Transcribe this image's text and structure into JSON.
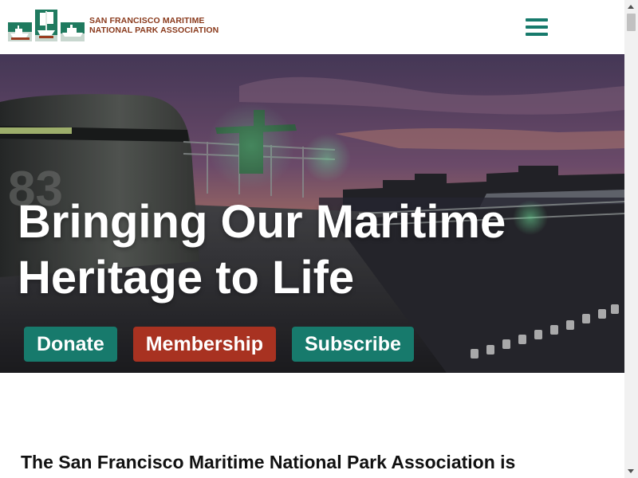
{
  "header": {
    "logo_line1": "SAN FRANCISCO MARITIME",
    "logo_line2": "NATIONAL PARK ASSOCIATION"
  },
  "hero": {
    "title_line1": "Bringing Our Maritime",
    "title_line2": "Heritage to Life",
    "hull_number": "83"
  },
  "actions": {
    "donate": "Donate",
    "membership": "Membership",
    "subscribe": "Subscribe"
  },
  "intro": {
    "text": "The San Francisco Maritime National Park Association is"
  },
  "colors": {
    "brand_green": "#177a6c",
    "brand_red": "#a83221",
    "logo_text": "#8a3a1c"
  },
  "icons": {
    "menu": "hamburger-menu-icon",
    "scroll_up": "scroll-up-arrow-icon",
    "scroll_down": "scroll-down-arrow-icon"
  }
}
